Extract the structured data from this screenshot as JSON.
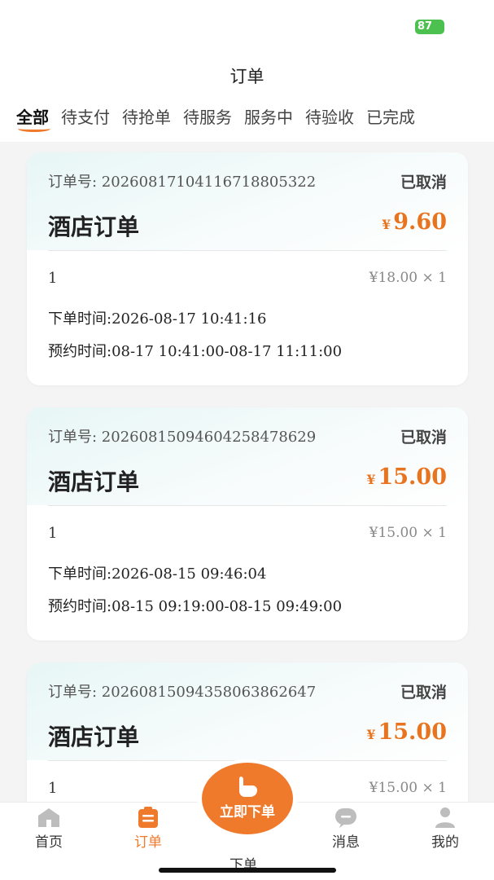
{
  "status_bar": {
    "battery": "87"
  },
  "header": {
    "title": "订单"
  },
  "tabs": [
    {
      "label": "全部",
      "active": true
    },
    {
      "label": "待支付"
    },
    {
      "label": "待抢单"
    },
    {
      "label": "待服务"
    },
    {
      "label": "服务中"
    },
    {
      "label": "待验收"
    },
    {
      "label": "已完成"
    }
  ],
  "orders": [
    {
      "order_no": "订单号: 20260817104116718805322",
      "status": "已取消",
      "type": "酒店订单",
      "currency": "¥",
      "amount": "9.60",
      "item_name": "1",
      "item_price": "¥18.00 × 1",
      "order_time": "下单时间:2026-08-17 10:41:16",
      "booking_time": "预约时间:08-17 10:41:00-08-17 11:11:00"
    },
    {
      "order_no": "订单号: 20260815094604258478629",
      "status": "已取消",
      "type": "酒店订单",
      "currency": "¥",
      "amount": "15.00",
      "item_name": "1",
      "item_price": "¥15.00 × 1",
      "order_time": "下单时间:2026-08-15 09:46:04",
      "booking_time": "预约时间:08-15 09:19:00-08-15 09:49:00"
    },
    {
      "order_no": "订单号: 20260815094358063862647",
      "status": "已取消",
      "type": "酒店订单",
      "currency": "¥",
      "amount": "15.00",
      "item_name": "1",
      "item_price": "¥15.00 × 1",
      "order_time": "",
      "booking_time": ""
    }
  ],
  "tabbar": {
    "home": "首页",
    "orders": "订单",
    "fab": "立即下单",
    "fab_caption": "下单",
    "messages": "消息",
    "mine": "我的"
  },
  "colors": {
    "accent": "#f07a2c",
    "price": "#e8741f",
    "battery": "#4cc14f"
  }
}
